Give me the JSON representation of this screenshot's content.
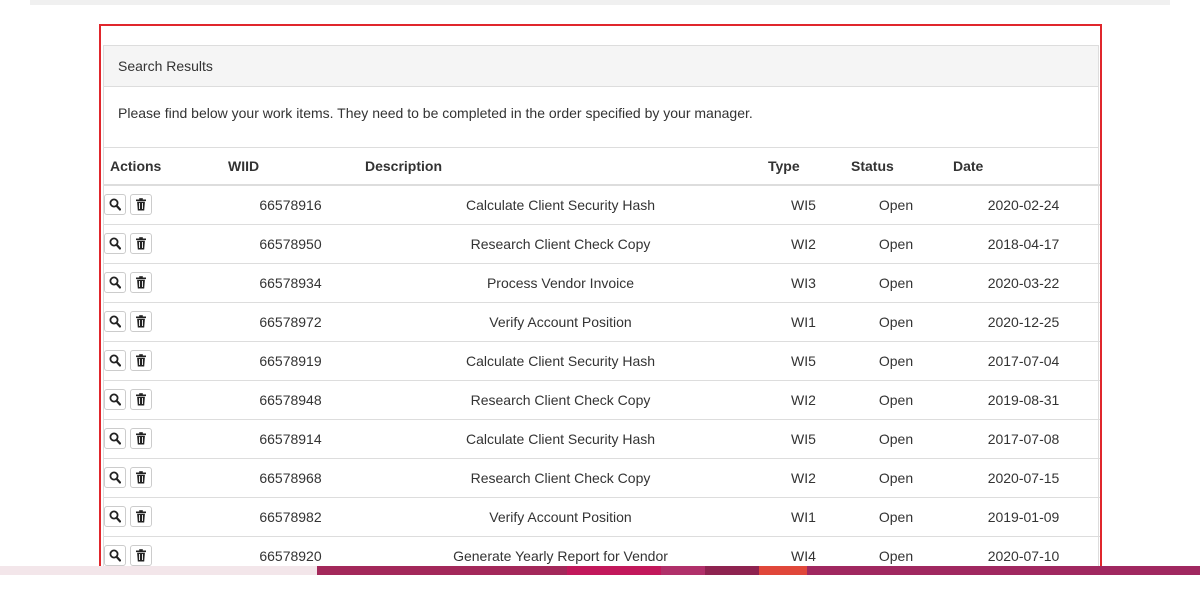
{
  "panel": {
    "heading": "Search Results",
    "intro": "Please find below your work items. They need to be completed in the order specified by your manager."
  },
  "table": {
    "headers": {
      "actions": "Actions",
      "wiid": "WIID",
      "description": "Description",
      "type": "Type",
      "status": "Status",
      "date": "Date"
    },
    "rows": [
      {
        "wiid": "66578916",
        "description": "Calculate Client Security Hash",
        "type": "WI5",
        "status": "Open",
        "date": "2020-02-24"
      },
      {
        "wiid": "66578950",
        "description": "Research Client Check Copy",
        "type": "WI2",
        "status": "Open",
        "date": "2018-04-17"
      },
      {
        "wiid": "66578934",
        "description": "Process Vendor Invoice",
        "type": "WI3",
        "status": "Open",
        "date": "2020-03-22"
      },
      {
        "wiid": "66578972",
        "description": "Verify Account Position",
        "type": "WI1",
        "status": "Open",
        "date": "2020-12-25"
      },
      {
        "wiid": "66578919",
        "description": "Calculate Client Security Hash",
        "type": "WI5",
        "status": "Open",
        "date": "2017-07-04"
      },
      {
        "wiid": "66578948",
        "description": "Research Client Check Copy",
        "type": "WI2",
        "status": "Open",
        "date": "2019-08-31"
      },
      {
        "wiid": "66578914",
        "description": "Calculate Client Security Hash",
        "type": "WI5",
        "status": "Open",
        "date": "2017-07-08"
      },
      {
        "wiid": "66578968",
        "description": "Research Client Check Copy",
        "type": "WI2",
        "status": "Open",
        "date": "2020-07-15"
      },
      {
        "wiid": "66578982",
        "description": "Verify Account Position",
        "type": "WI1",
        "status": "Open",
        "date": "2019-01-09"
      },
      {
        "wiid": "66578920",
        "description": "Generate Yearly Report for Vendor",
        "type": "WI4",
        "status": "Open",
        "date": "2020-07-10"
      }
    ],
    "row_actions": [
      "search-icon",
      "trash-icon"
    ]
  },
  "colors": {
    "highlight_border": "#e0262c",
    "bottom_bar": [
      "#f3e6ea",
      "#a3285a",
      "#c2185b",
      "#b0306a",
      "#8e2350",
      "#e0473a",
      "#a02860"
    ]
  }
}
